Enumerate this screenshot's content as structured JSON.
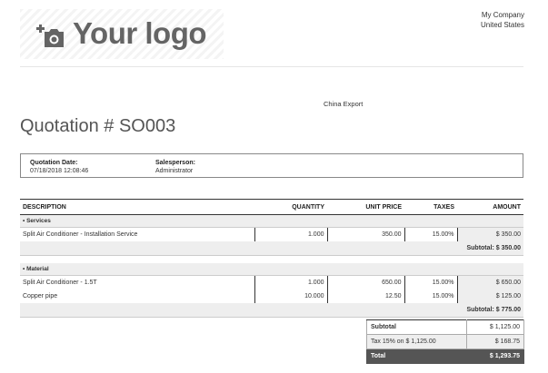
{
  "logo": {
    "text": "Your logo",
    "icon": "camera-plus-icon"
  },
  "company": {
    "name": "My Company",
    "country": "United States"
  },
  "partner": "China Export",
  "title": "Quotation # SO003",
  "info": {
    "date_label": "Quotation Date:",
    "date_value": "07/18/2018 12:08:46",
    "salesperson_label": "Salesperson:",
    "salesperson_value": "Administrator"
  },
  "table": {
    "headers": {
      "description": "DESCRIPTION",
      "quantity": "QUANTITY",
      "unit_price": "UNIT PRICE",
      "taxes": "TAXES",
      "amount": "AMOUNT"
    },
    "sections": [
      {
        "name": "Services",
        "lines": [
          {
            "description": "Split Air Conditioner - Installation Service",
            "quantity": "1.000",
            "unit_price": "350.00",
            "taxes": "15.00%",
            "amount": "$ 350.00"
          }
        ],
        "subtotal": "Subtotal: $ 350.00"
      },
      {
        "name": "Material",
        "lines": [
          {
            "description": "Split Air Conditioner - 1.5T",
            "quantity": "1.000",
            "unit_price": "650.00",
            "taxes": "15.00%",
            "amount": "$ 650.00"
          },
          {
            "description": "Copper pipe",
            "quantity": "10.000",
            "unit_price": "12.50",
            "taxes": "15.00%",
            "amount": "$ 125.00"
          }
        ],
        "subtotal": "Subtotal: $ 775.00"
      }
    ]
  },
  "totals": {
    "subtotal_label": "Subtotal",
    "subtotal_value": "$ 1,125.00",
    "tax_label": "Tax 15% on $ 1,125.00",
    "tax_value": "$ 168.75",
    "total_label": "Total",
    "total_value": "$ 1,293.75"
  },
  "colors": {
    "accent_dark": "#555555",
    "section_bg": "#eeeeee"
  }
}
